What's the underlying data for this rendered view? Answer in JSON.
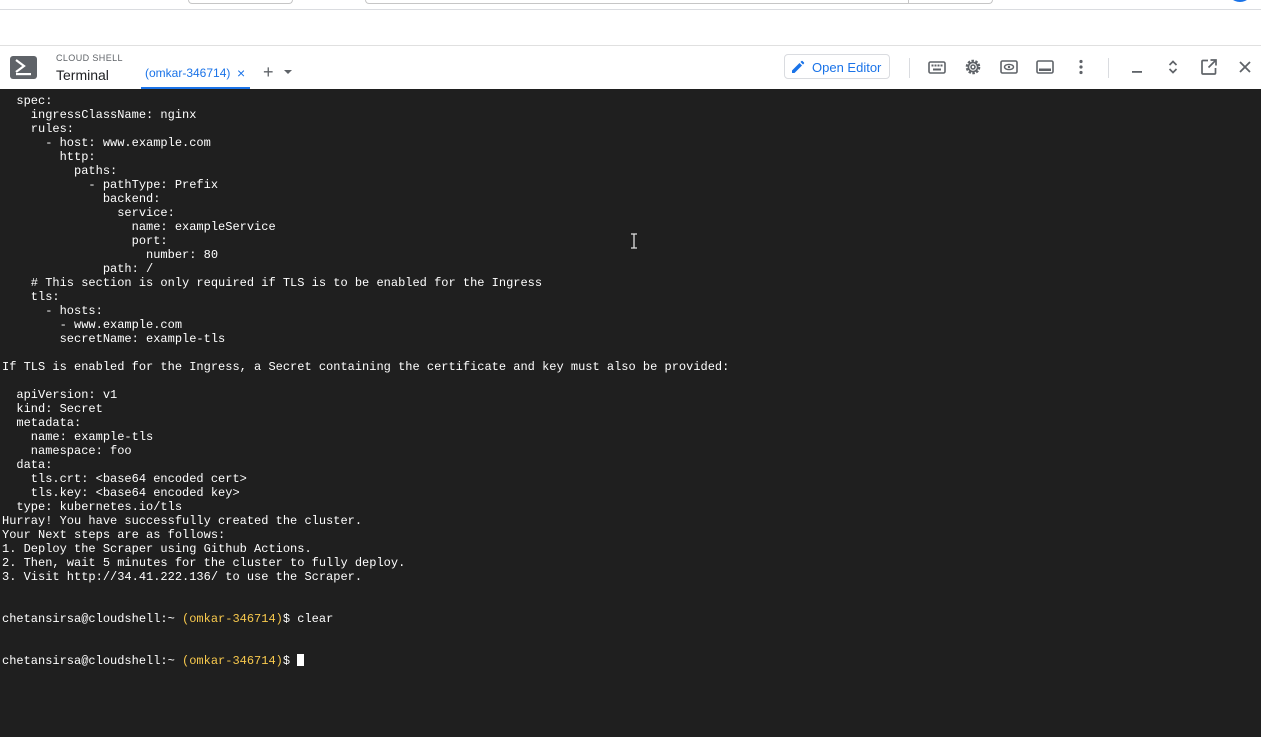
{
  "shell": {
    "brand": "CLOUD SHELL",
    "title": "Terminal",
    "tab_label": "(omkar-346714)",
    "tab_close": "×",
    "add_tab": "+",
    "open_editor_label": "Open Editor"
  },
  "icons": {
    "logo": "cloud-shell-terminal-icon",
    "open_editor": "pencil-icon",
    "toolbar": [
      "keyboard-icon",
      "settings-gear-icon",
      "web-preview-icon",
      "layout-panel-icon",
      "more-vert-icon",
      "minimize-icon",
      "restore-icon",
      "open-new-window-icon",
      "close-icon"
    ]
  },
  "colors": {
    "accent": "#1a73e8",
    "terminal_bg": "#1f1f1f",
    "terminal_fg": "#ffffff",
    "prompt_project": "#f8c94d"
  },
  "terminal": {
    "lines": [
      "  spec:",
      "    ingressClassName: nginx",
      "    rules:",
      "      - host: www.example.com",
      "        http:",
      "          paths:",
      "            - pathType: Prefix",
      "              backend:",
      "                service:",
      "                  name: exampleService",
      "                  port:",
      "                    number: 80",
      "              path: /",
      "    # This section is only required if TLS is to be enabled for the Ingress",
      "    tls:",
      "      - hosts:",
      "        - www.example.com",
      "        secretName: example-tls",
      "",
      "If TLS is enabled for the Ingress, a Secret containing the certificate and key must also be provided:",
      "",
      "  apiVersion: v1",
      "  kind: Secret",
      "  metadata:",
      "    name: example-tls",
      "    namespace: foo",
      "  data:",
      "    tls.crt: <base64 encoded cert>",
      "    tls.key: <base64 encoded key>",
      "  type: kubernetes.io/tls",
      "Hurray! You have successfully created the cluster.",
      "Your Next steps are as follows:",
      "1. Deploy the Scraper using Github Actions.",
      "2. Then, wait 5 minutes for the cluster to fully deploy.",
      "3. Visit http://34.41.222.136/ to use the Scraper."
    ],
    "prompt_user": "chetansirsa@cloudshell:~",
    "prompt_project": "(omkar-346714)",
    "prompt_symbol": "$",
    "history_command": "clear"
  }
}
